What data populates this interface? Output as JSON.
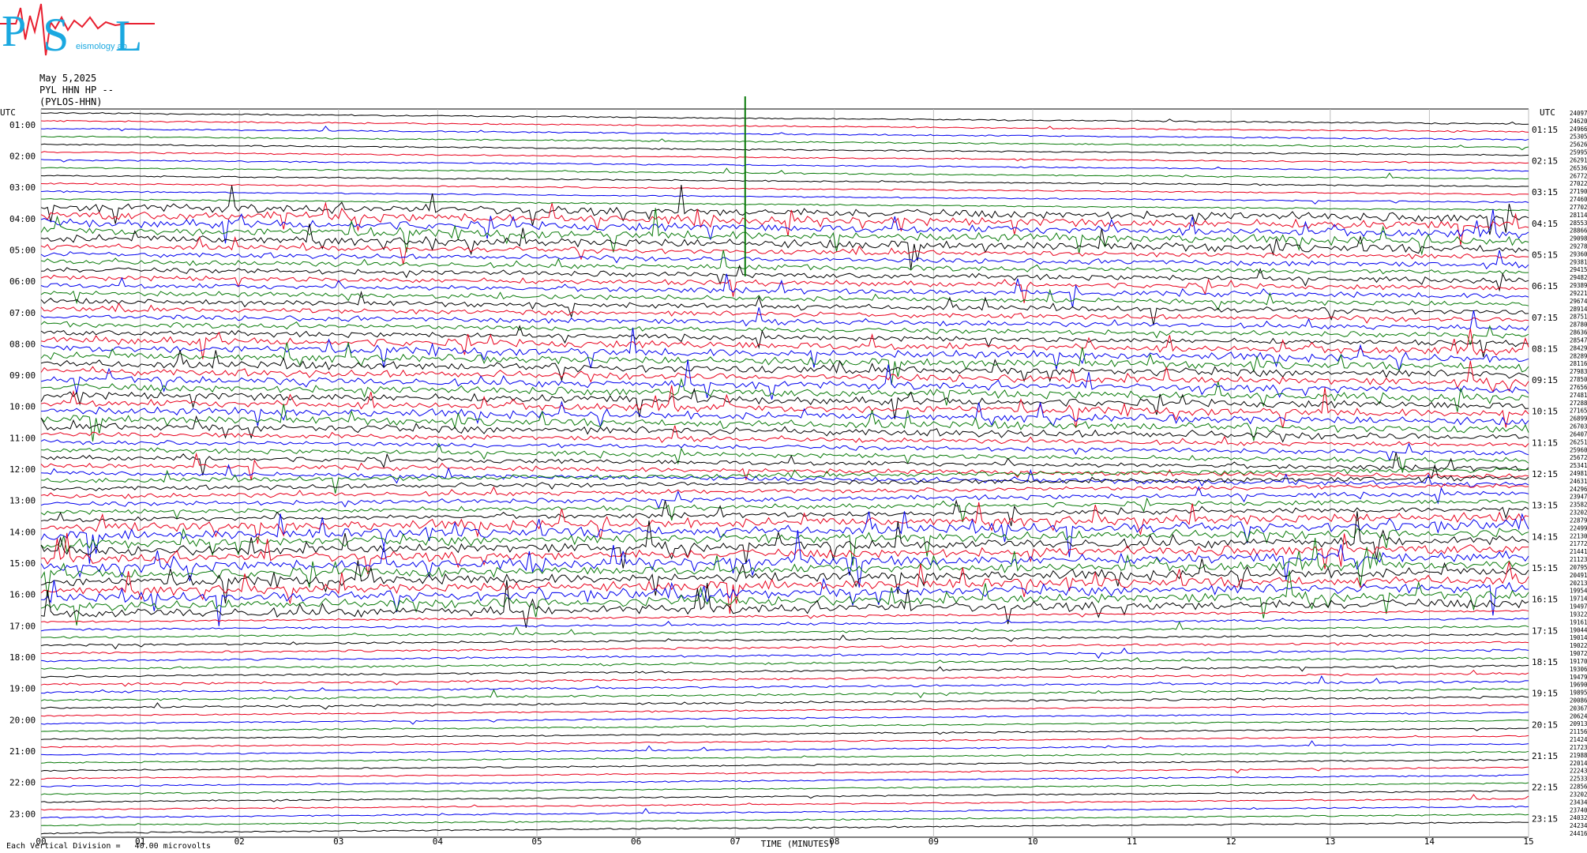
{
  "header": {
    "date": "May 5,2025",
    "station": "PYL HHN HP --",
    "location": "(PYLOS-HHN)",
    "left_axis_label": "UTC",
    "right_axis_label": "UTC"
  },
  "logo": {
    "text_p": "P",
    "text_s": "S",
    "text_l": "L",
    "small_text": "eismology  ab",
    "colors": {
      "letters": "#1aa8e0",
      "trace": "#e81f2f"
    }
  },
  "footer": {
    "vertical_division": "Each Vertical Division =   40.00 microvolts",
    "time_label": "TIME (MINUTES)"
  },
  "chart_data": {
    "type": "line",
    "title": "",
    "xlabel": "TIME (MINUTES)",
    "x_ticks": [
      "00",
      "01",
      "02",
      "03",
      "04",
      "05",
      "06",
      "07",
      "08",
      "09",
      "10",
      "11",
      "12",
      "13",
      "14",
      "15"
    ],
    "xlim": [
      0,
      15
    ],
    "rows_per_hour": 4,
    "left_hour_labels": [
      "01:00",
      "02:00",
      "03:00",
      "04:00",
      "05:00",
      "06:00",
      "07:00",
      "08:00",
      "09:00",
      "10:00",
      "11:00",
      "12:00",
      "13:00",
      "14:00",
      "15:00",
      "16:00",
      "17:00",
      "18:00",
      "19:00",
      "20:00",
      "21:00",
      "22:00",
      "23:00"
    ],
    "right_hour_labels": [
      "01:15",
      "02:15",
      "03:15",
      "04:15",
      "05:15",
      "06:15",
      "07:15",
      "08:15",
      "09:15",
      "10:15",
      "11:15",
      "12:15",
      "13:15",
      "14:15",
      "15:15",
      "16:15",
      "17:15",
      "18:15",
      "19:15",
      "20:15",
      "21:15",
      "22:15",
      "23:15"
    ],
    "trace_colors": [
      "#000000",
      "#e8001c",
      "#0000ee",
      "#0a7a0a"
    ],
    "right_counts": [
      "24097",
      "24620",
      "24966",
      "25305",
      "25626",
      "25995",
      "26291",
      "26536",
      "26772",
      "27022",
      "27190",
      "27460",
      "27702",
      "28114",
      "28553",
      "28866",
      "29098",
      "29278",
      "29360",
      "29381",
      "29415",
      "29482",
      "29389",
      "29221",
      "29674",
      "28914",
      "28751",
      "28780",
      "28636",
      "28547",
      "28429",
      "28289",
      "28116",
      "27983",
      "27850",
      "27656",
      "27481",
      "27288",
      "27165",
      "26899",
      "26703",
      "26407",
      "26251",
      "25960",
      "25672",
      "25341",
      "24981",
      "24631",
      "24296",
      "23947",
      "23582",
      "23202",
      "22879",
      "22499",
      "22130",
      "21772",
      "21441",
      "21123",
      "20795",
      "20491",
      "20213",
      "19954",
      "19714",
      "19497",
      "19322",
      "19161",
      "19044",
      "19014",
      "19022",
      "19072",
      "19170",
      "19306",
      "19479",
      "19690",
      "19895",
      "20086",
      "20367",
      "20624",
      "20913",
      "21156",
      "21424",
      "21723",
      "21988",
      "22014",
      "22243",
      "22533",
      "22856",
      "23202",
      "23434",
      "23740",
      "24032",
      "24234",
      "24416"
    ],
    "activity_profile": [
      {
        "from_row": 0,
        "to_row": 11,
        "level": 0.6
      },
      {
        "from_row": 12,
        "to_row": 16,
        "level": 3.5
      },
      {
        "from_row": 17,
        "to_row": 28,
        "level": 2.2
      },
      {
        "from_row": 29,
        "to_row": 40,
        "level": 3.2
      },
      {
        "from_row": 41,
        "to_row": 52,
        "level": 2.0
      },
      {
        "from_row": 53,
        "to_row": 64,
        "level": 4.0
      },
      {
        "from_row": 65,
        "to_row": 76,
        "level": 0.9
      },
      {
        "from_row": 77,
        "to_row": 94,
        "level": 0.6
      }
    ]
  }
}
